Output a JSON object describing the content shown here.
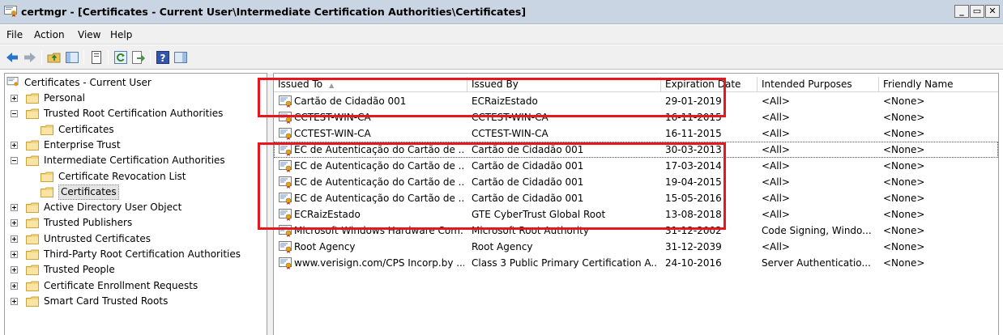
{
  "window": {
    "title": "certmgr - [Certificates - Current User\\Intermediate Certification Authorities\\Certificates]",
    "minimize_label": "_",
    "restore_label": "▭",
    "close_label": "✕"
  },
  "menu": {
    "file": "File",
    "action": "Action",
    "view": "View",
    "help": "Help"
  },
  "tree": {
    "root": "Certificates - Current User",
    "items": [
      "Personal",
      "Trusted Root Certification Authorities",
      "Certificates",
      "Enterprise Trust",
      "Intermediate Certification Authorities",
      "Certificate Revocation List",
      "Certificates",
      "Active Directory User Object",
      "Trusted Publishers",
      "Untrusted Certificates",
      "Third-Party Root Certification Authorities",
      "Trusted People",
      "Certificate Enrollment Requests",
      "Smart Card Trusted Roots"
    ]
  },
  "columns": {
    "issued_to": "Issued To",
    "issued_by": "Issued By",
    "expiration": "Expiration Date",
    "purposes": "Intended Purposes",
    "friendly": "Friendly Name"
  },
  "rows": [
    {
      "issued_to": "Cartão de Cidadão 001",
      "issued_by": "ECRaizEstado",
      "expiration": "29-01-2019",
      "purposes": "<All>",
      "friendly": "<None>"
    },
    {
      "issued_to": "CCTEST-WIN-CA",
      "issued_by": "CCTEST-WIN-CA",
      "expiration": "16-11-2015",
      "purposes": "<All>",
      "friendly": "<None>"
    },
    {
      "issued_to": "CCTEST-WIN-CA",
      "issued_by": "CCTEST-WIN-CA",
      "expiration": "16-11-2015",
      "purposes": "<All>",
      "friendly": "<None>"
    },
    {
      "issued_to": "EC de Autenticação do Cartão de ...",
      "issued_by": "Cartão de Cidadão 001",
      "expiration": "30-03-2013",
      "purposes": "<All>",
      "friendly": "<None>"
    },
    {
      "issued_to": "EC de Autenticação do Cartão de ...",
      "issued_by": "Cartão de Cidadão 001",
      "expiration": "17-03-2014",
      "purposes": "<All>",
      "friendly": "<None>"
    },
    {
      "issued_to": "EC de Autenticação do Cartão de ...",
      "issued_by": "Cartão de Cidadão 001",
      "expiration": "19-04-2015",
      "purposes": "<All>",
      "friendly": "<None>"
    },
    {
      "issued_to": "EC de Autenticação do Cartão de ...",
      "issued_by": "Cartão de Cidadão 001",
      "expiration": "15-05-2016",
      "purposes": "<All>",
      "friendly": "<None>"
    },
    {
      "issued_to": "ECRaizEstado",
      "issued_by": "GTE CyberTrust Global Root",
      "expiration": "13-08-2018",
      "purposes": "<All>",
      "friendly": "<None>"
    },
    {
      "issued_to": "Microsoft Windows Hardware Com...",
      "issued_by": "Microsoft Root Authority",
      "expiration": "31-12-2002",
      "purposes": "Code Signing, Windo...",
      "friendly": "<None>"
    },
    {
      "issued_to": "Root Agency",
      "issued_by": "Root Agency",
      "expiration": "31-12-2039",
      "purposes": "<All>",
      "friendly": "<None>"
    },
    {
      "issued_to": "www.verisign.com/CPS Incorp.by ...",
      "issued_by": "Class 3 Public Primary Certification A...",
      "expiration": "24-10-2016",
      "purposes": "Server Authenticatio...",
      "friendly": "<None>"
    }
  ],
  "colors": {
    "highlight": "#e8161d",
    "titlebar": "#c9d5e3"
  }
}
